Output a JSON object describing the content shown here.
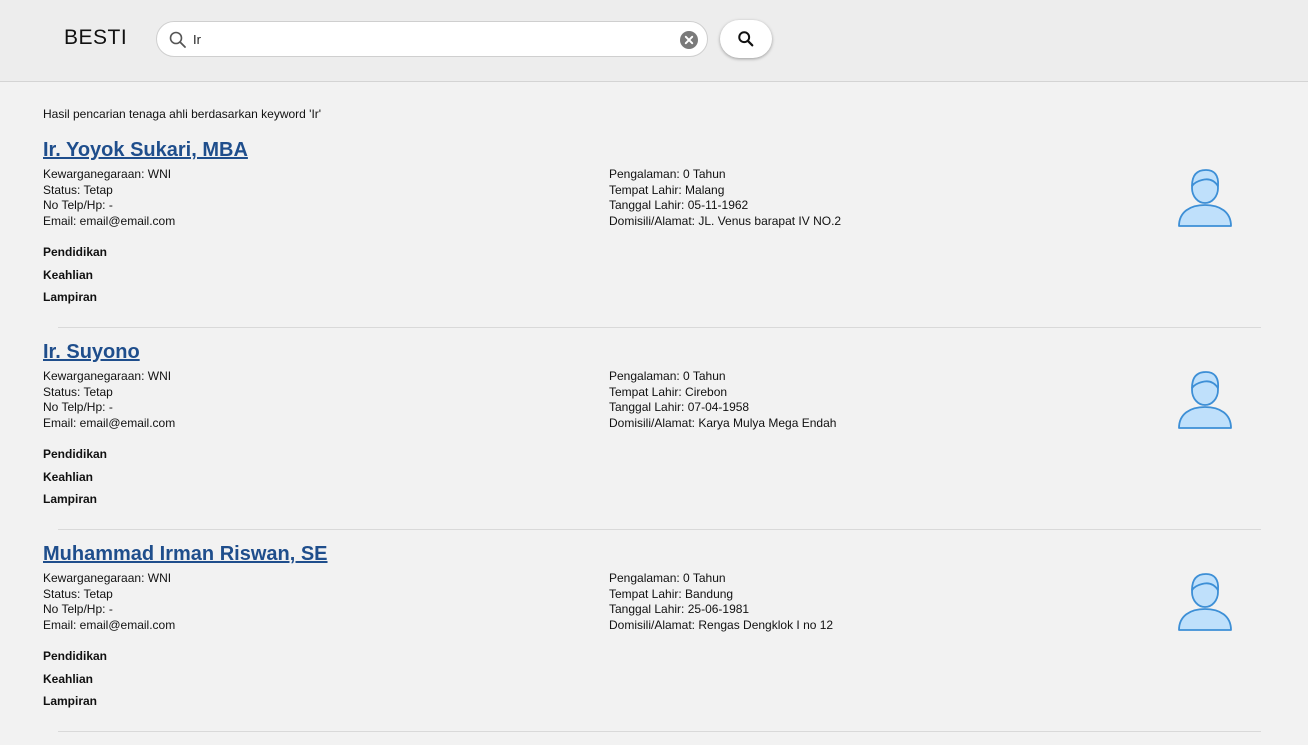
{
  "header": {
    "brand": "BESTI",
    "search_value": "Ir",
    "icons": {
      "search": "search-icon",
      "clear": "clear-icon"
    }
  },
  "results_caption": "Hasil pencarian tenaga ahli berdasarkan keyword 'Ir'",
  "labels": {
    "pendidikan": "Pendidikan",
    "keahlian": "Keahlian",
    "lampiran": "Lampiran"
  },
  "results": [
    {
      "name": "Ir. Yoyok Sukari, MBA",
      "kewarganegaraan": "Kewarganegaraan: WNI",
      "status": "Status: Tetap",
      "telp": "No Telp/Hp: -",
      "email": "Email: email@email.com",
      "pengalaman": "Pengalaman: 0 Tahun",
      "tempat_lahir": "Tempat Lahir: Malang",
      "tanggal_lahir": "Tanggal Lahir: 05-11-1962",
      "domisili": "Domisili/Alamat: JL. Venus barapat IV NO.2"
    },
    {
      "name": "Ir. Suyono",
      "kewarganegaraan": "Kewarganegaraan: WNI",
      "status": "Status: Tetap",
      "telp": "No Telp/Hp: -",
      "email": "Email: email@email.com",
      "pengalaman": "Pengalaman: 0 Tahun",
      "tempat_lahir": "Tempat Lahir: Cirebon",
      "tanggal_lahir": "Tanggal Lahir: 07-04-1958",
      "domisili": "Domisili/Alamat: Karya Mulya Mega Endah"
    },
    {
      "name": "Muhammad Irman Riswan, SE",
      "kewarganegaraan": "Kewarganegaraan: WNI",
      "status": "Status: Tetap",
      "telp": "No Telp/Hp: -",
      "email": "Email: email@email.com",
      "pengalaman": "Pengalaman: 0 Tahun",
      "tempat_lahir": "Tempat Lahir: Bandung",
      "tanggal_lahir": "Tanggal Lahir: 25-06-1981",
      "domisili": "Domisili/Alamat: Rengas Dengklok I no 12"
    }
  ],
  "colors": {
    "link": "#1f4e8c",
    "avatar_fill": "#bfe0fb",
    "avatar_stroke": "#3d8fd6"
  }
}
